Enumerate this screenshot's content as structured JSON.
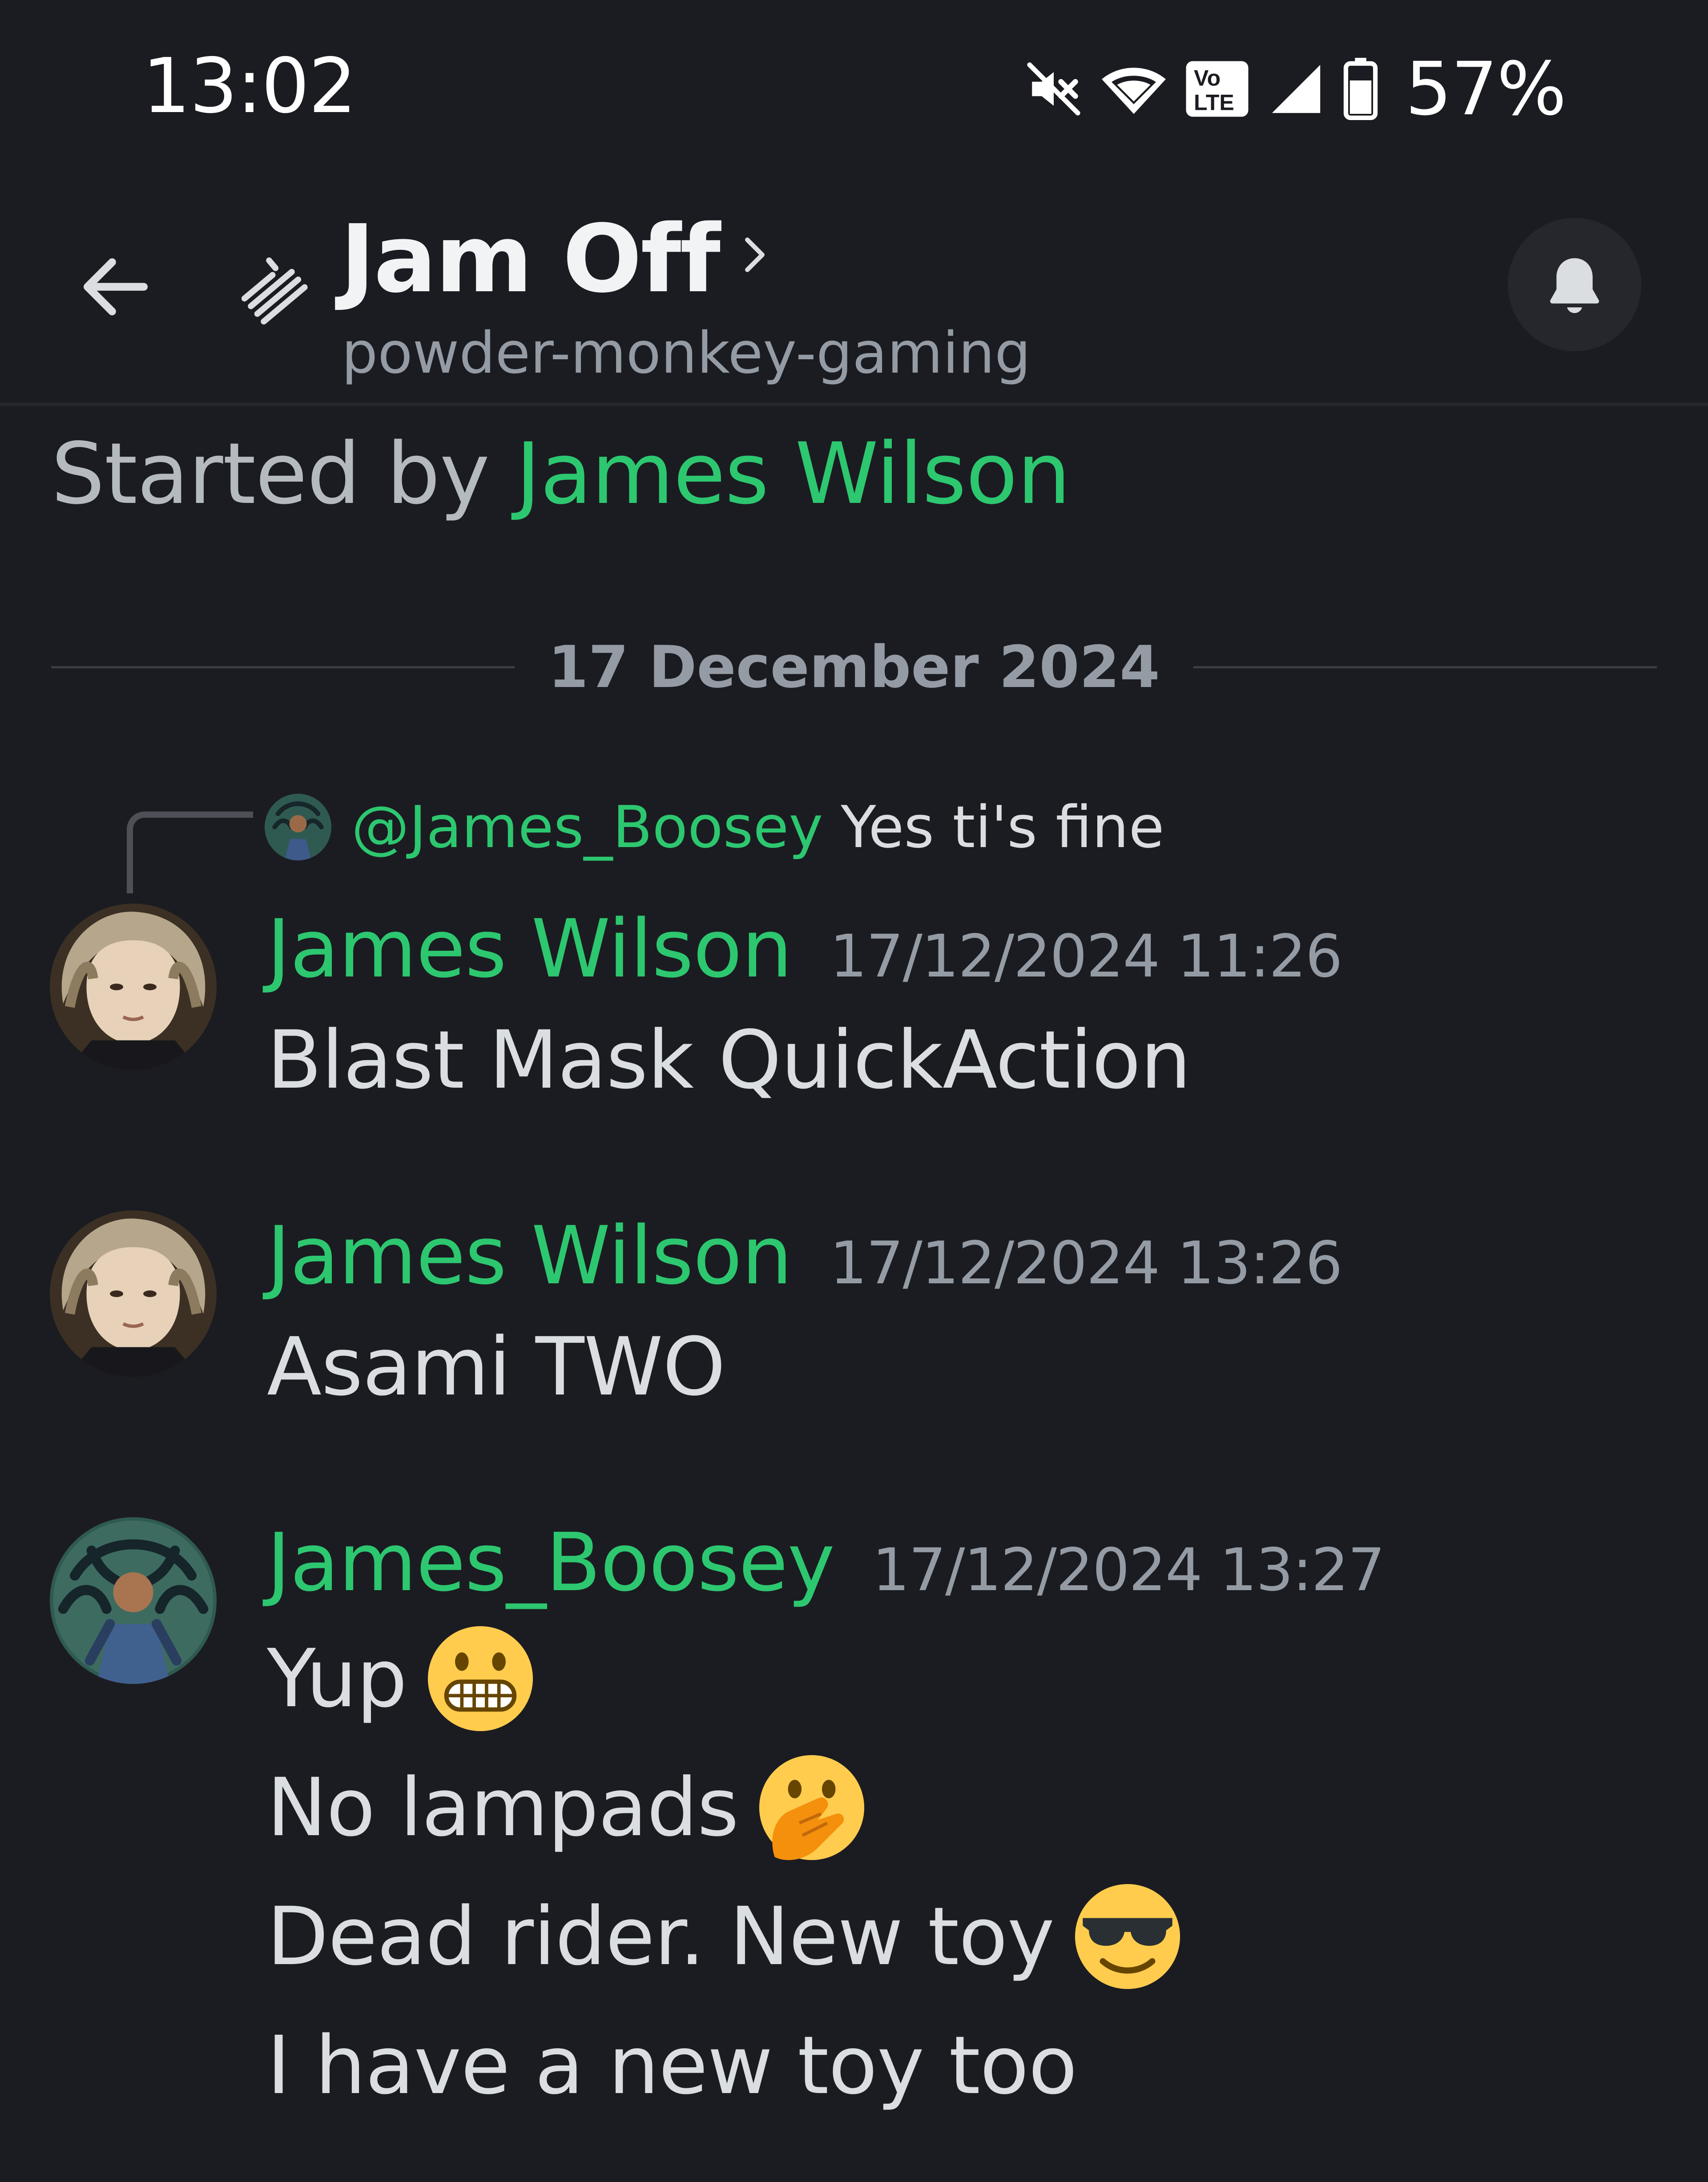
{
  "status_bar": {
    "time": "13:02",
    "battery": "57%",
    "icons": [
      "mute-icon",
      "wifi-icon",
      "volte-icon",
      "signal-icon",
      "battery-icon"
    ],
    "volte_label_top": "Vo",
    "volte_label_bottom": "LTE"
  },
  "header": {
    "title": "Jam Off",
    "subtitle": "powder-monkey-gaming",
    "back_icon": "arrow-left-icon",
    "thread_icon": "thread-icon",
    "bell_icon": "bell-icon"
  },
  "thread": {
    "started_prefix": "Started by ",
    "started_author": "James Wilson",
    "date_divider": "17 December 2024"
  },
  "reply_preview": {
    "mention": "@James_Boosey",
    "text": "Yes ti's fine"
  },
  "messages": [
    {
      "author": "James Wilson",
      "timestamp": "17/12/2024 11:26",
      "lines": [
        "Blast Mask QuickAction"
      ]
    },
    {
      "author": "James Wilson",
      "timestamp": "17/12/2024 13:26",
      "lines": [
        "Asami TWO"
      ]
    },
    {
      "author": "James_Boosey",
      "timestamp": "17/12/2024 13:27",
      "lines": [
        {
          "text": "Yup",
          "emoji": "grimacing-face-emoji"
        },
        {
          "text": "No lampads",
          "emoji": "face-with-hand-over-mouth-emoji"
        },
        {
          "text": "Dead rider. New toy",
          "emoji": "smiling-face-with-sunglasses-emoji"
        },
        {
          "text": "I have a new toy too"
        }
      ]
    }
  ],
  "colors": {
    "background": "#1b1c21",
    "username_green": "#2dc770",
    "muted_text": "#949ba4",
    "primary_text": "#dbdee1"
  }
}
